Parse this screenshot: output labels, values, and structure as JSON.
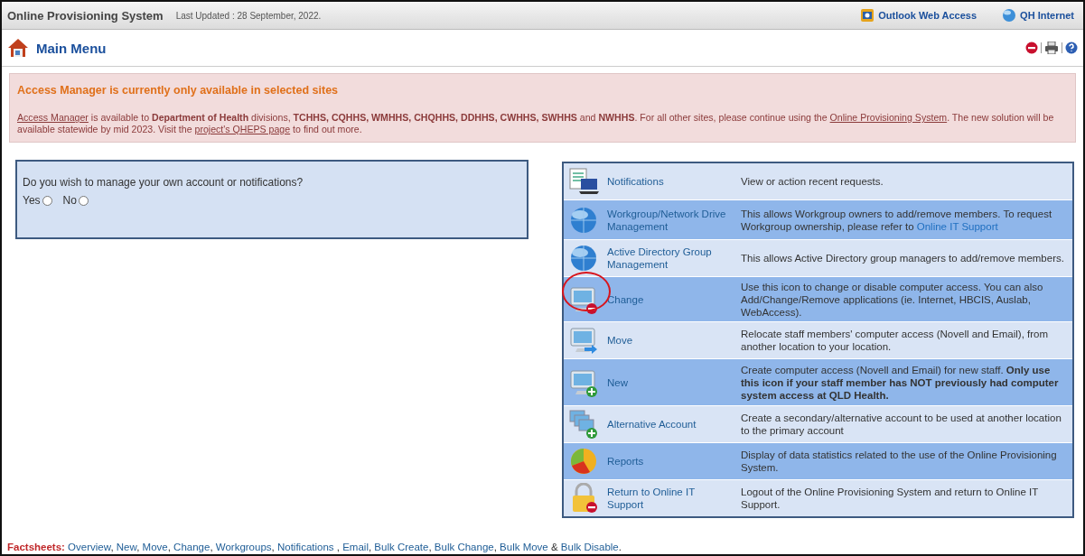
{
  "header": {
    "title": "Online Provisioning System",
    "updated": "Last Updated : 28 September, 2022.",
    "links": [
      {
        "label": "Outlook Web Access"
      },
      {
        "label": "QH Internet"
      }
    ]
  },
  "page": {
    "title": "Main Menu"
  },
  "banner": {
    "title": "Access Manager is currently only available in selected sites",
    "segments": [
      {
        "kind": "link",
        "text": "Access Manager"
      },
      {
        "kind": "plain",
        "text": " is available to **Department of Health** divisions, **TCHHS, CQHHS, WMHHS, CHQHHS, DDHHS, CWHHS, SWHHS** and **NWHHS**. For all other sites, please continue using the "
      },
      {
        "kind": "link",
        "text": "Online Provisioning System"
      },
      {
        "kind": "plain",
        "text": ". The new solution will be available statewide by mid 2023. Visit the "
      },
      {
        "kind": "link",
        "text": "project's QHEPS page"
      },
      {
        "kind": "plain",
        "text": " to find out more."
      }
    ]
  },
  "question": {
    "text": "Do you wish to manage your own account or notifications?",
    "options": [
      {
        "label": "Yes",
        "selected": false
      },
      {
        "label": "No",
        "selected": false
      }
    ]
  },
  "menu": [
    {
      "label": "Notifications",
      "circled": false,
      "description": [
        {
          "kind": "plain",
          "text": "View or action recent requests."
        }
      ]
    },
    {
      "label": "Workgroup/Network Drive Management",
      "circled": false,
      "description": [
        {
          "kind": "plain",
          "text": "This allows Workgroup owners to add/remove members. To request Workgroup ownership, please refer to "
        },
        {
          "kind": "link",
          "text": "Online IT Support"
        }
      ]
    },
    {
      "label": "Active Directory Group Management",
      "circled": false,
      "description": [
        {
          "kind": "plain",
          "text": "This allows Active Directory group managers to add/remove members."
        }
      ]
    },
    {
      "label": "Change",
      "circled": true,
      "description": [
        {
          "kind": "plain",
          "text": "Use this icon to change or disable computer access. You can also Add/Change/Remove applications (ie. Internet, HBCIS, Auslab, WebAccess)."
        }
      ]
    },
    {
      "label": "Move",
      "circled": false,
      "description": [
        {
          "kind": "plain",
          "text": "Relocate staff members' computer access (Novell and Email), from another location to your location."
        }
      ]
    },
    {
      "label": "New",
      "circled": false,
      "description": [
        {
          "kind": "plain",
          "text": "Create computer access (Novell and Email) for new staff. **Only use this icon if your staff member has NOT previously had computer system access at QLD Health.**"
        }
      ]
    },
    {
      "label": "Alternative Account",
      "circled": false,
      "description": [
        {
          "kind": "plain",
          "text": "Create a secondary/alternative account to be used at another location to the primary account"
        }
      ]
    },
    {
      "label": "Reports",
      "circled": false,
      "description": [
        {
          "kind": "plain",
          "text": "Display of data statistics related to the use of the Online Provisioning System."
        }
      ]
    },
    {
      "label": "Return to Online IT Support",
      "circled": false,
      "description": [
        {
          "kind": "plain",
          "text": "Logout of the Online Provisioning System and return to Online IT Support."
        }
      ]
    }
  ],
  "factsheets": {
    "label": "Factsheets:",
    "segments": [
      {
        "kind": "link",
        "text": "Overview"
      },
      {
        "kind": "plain",
        "text": ", "
      },
      {
        "kind": "link",
        "text": "New"
      },
      {
        "kind": "plain",
        "text": ", "
      },
      {
        "kind": "link",
        "text": "Move"
      },
      {
        "kind": "plain",
        "text": ", "
      },
      {
        "kind": "link",
        "text": "Change"
      },
      {
        "kind": "plain",
        "text": ", "
      },
      {
        "kind": "link",
        "text": "Workgroups"
      },
      {
        "kind": "plain",
        "text": ", "
      },
      {
        "kind": "link",
        "text": "Notifications"
      },
      {
        "kind": "plain",
        "text": " , "
      },
      {
        "kind": "link",
        "text": "Email"
      },
      {
        "kind": "plain",
        "text": ", "
      },
      {
        "kind": "link",
        "text": "Bulk Create"
      },
      {
        "kind": "plain",
        "text": ", "
      },
      {
        "kind": "link",
        "text": "Bulk Change"
      },
      {
        "kind": "plain",
        "text": ", "
      },
      {
        "kind": "link",
        "text": "Bulk Move"
      },
      {
        "kind": "plain",
        "text": " & "
      },
      {
        "kind": "link",
        "text": "Bulk Disable"
      },
      {
        "kind": "plain",
        "text": "."
      }
    ]
  }
}
